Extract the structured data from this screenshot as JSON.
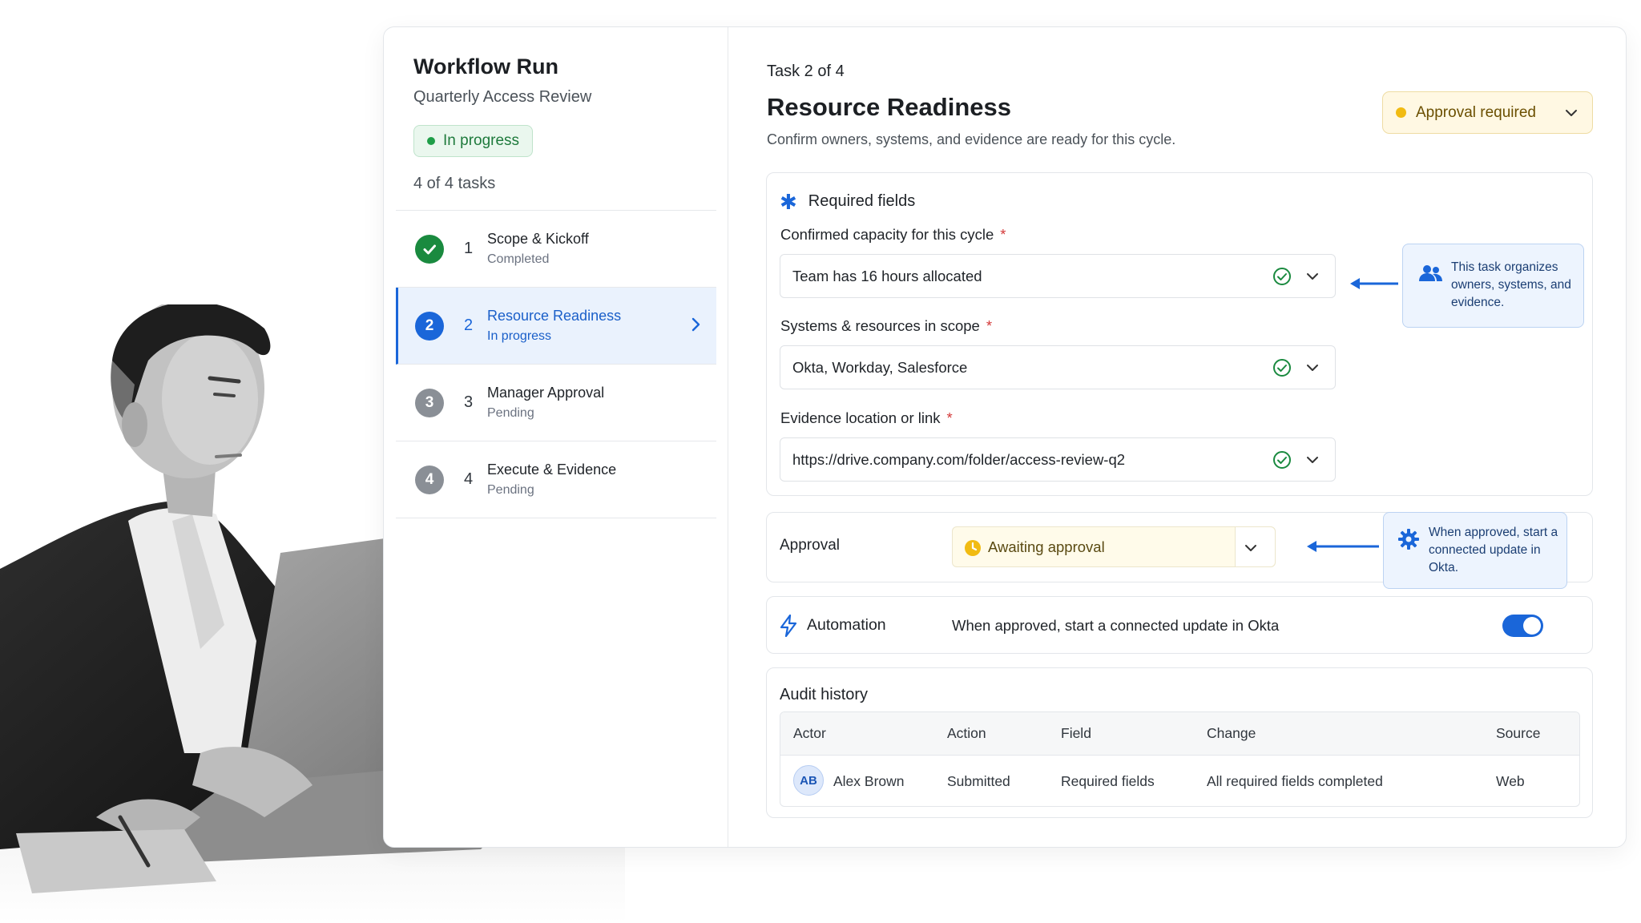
{
  "workflow": {
    "title": "Workflow Run",
    "subtitle": "Quarterly Access Review",
    "status": "In progress",
    "task_count": "4 of 4 tasks"
  },
  "steps": [
    {
      "num": "1",
      "name": "Scope & Kickoff",
      "state": "Completed",
      "kind": "done"
    },
    {
      "num": "2",
      "name": "Resource Readiness",
      "state": "In progress",
      "kind": "active"
    },
    {
      "num": "3",
      "name": "Manager Approval",
      "state": "Pending",
      "kind": "pending"
    },
    {
      "num": "4",
      "name": "Execute & Evidence",
      "state": "Pending",
      "kind": "pending"
    }
  ],
  "task": {
    "position": "Task 2 of 4",
    "title": "Resource Readiness",
    "description": "Confirm owners, systems, and evidence are ready for this cycle.",
    "approval_chip": "Approval required"
  },
  "required": {
    "heading": "Required fields",
    "fields": [
      {
        "label": "Confirmed capacity for this cycle",
        "value": "Team has 16 hours allocated"
      },
      {
        "label": "Systems & resources in scope",
        "value": "Okta, Workday, Salesforce"
      },
      {
        "label": "Evidence location or link",
        "value": "https://drive.company.com/folder/access-review-q2"
      }
    ],
    "required_mark": "*",
    "callout": "This task organizes owners, systems, and evidence."
  },
  "approval": {
    "label": "Approval",
    "value": "Awaiting approval",
    "callout": "When approved, start a connected update in Okta."
  },
  "automation": {
    "label": "Automation",
    "text": "When approved, start a connected update in Okta",
    "enabled": true
  },
  "audit": {
    "title": "Audit history",
    "columns": [
      "Actor",
      "Action",
      "Field",
      "Change",
      "Source"
    ],
    "rows": [
      {
        "initials": "AB",
        "actor": "Alex Brown",
        "action": "Submitted",
        "field": "Required fields",
        "change": "All required fields completed",
        "source": "Web"
      }
    ]
  },
  "colors": {
    "accent": "#1a66d9",
    "success": "#1a8a3f",
    "warning": "#f1bb12",
    "required": "#d43b3b"
  },
  "icons": [
    "check-icon",
    "chevron-right-icon",
    "chevron-down-icon",
    "check-circle-icon",
    "users-icon",
    "gear-icon",
    "clock-icon",
    "bolt-icon",
    "arrow-left-icon"
  ]
}
